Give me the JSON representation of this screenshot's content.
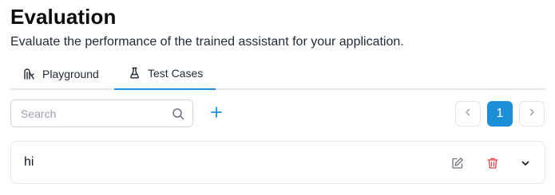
{
  "header": {
    "title": "Evaluation",
    "subtitle": "Evaluate the performance of the trained assistant for your application."
  },
  "tabs": [
    {
      "label": "Playground",
      "icon": "playground-icon",
      "active": false
    },
    {
      "label": "Test Cases",
      "icon": "flask-icon",
      "active": true
    }
  ],
  "toolbar": {
    "search_placeholder": "Search",
    "add_icon": "plus-icon"
  },
  "pagination": {
    "current_page": "1",
    "prev_icon": "chevron-left-icon",
    "next_icon": "chevron-right-icon"
  },
  "test_cases": [
    {
      "label": "hi",
      "edit_icon": "edit-icon",
      "delete_icon": "trash-icon",
      "expand_icon": "chevron-down-icon"
    }
  ],
  "colors": {
    "accent": "#1d8fd8",
    "danger": "#ef4444",
    "border": "#e5e7eb"
  }
}
